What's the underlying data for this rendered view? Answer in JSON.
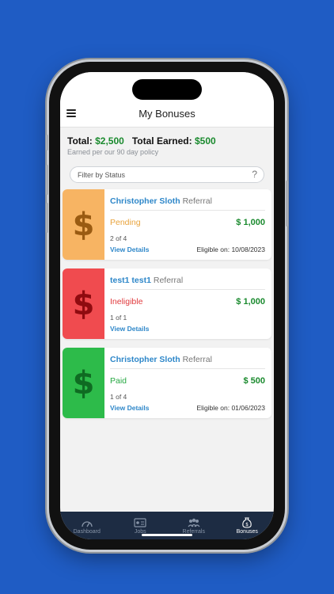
{
  "header": {
    "title": "My Bonuses",
    "menu_icon": "hamburger-icon"
  },
  "summary": {
    "total_label": "Total:",
    "total_value": "$2,500",
    "earned_label": "Total Earned:",
    "earned_value": "$500",
    "policy": "Earned per our 90 day policy"
  },
  "filter": {
    "placeholder": "Filter by Status",
    "help": "?"
  },
  "bonuses": [
    {
      "name": "Christopher Sloth",
      "type": "Referral",
      "status": "Pending",
      "amount": "$ 1,000",
      "count": "2 of 4",
      "view_label": "View Details",
      "eligible": "Eligible on: 10/08/2023",
      "side_color": "#f7b463",
      "icon_color": "#9a5b12",
      "status_color": "#e8a33c"
    },
    {
      "name": "test1 test1",
      "type": "Referral",
      "status": "Ineligible",
      "amount": "$ 1,000",
      "count": "1 of 1",
      "view_label": "View Details",
      "eligible": "",
      "side_color": "#f04b4f",
      "icon_color": "#8f0b10",
      "status_color": "#e0393c"
    },
    {
      "name": "Christopher Sloth",
      "type": "Referral",
      "status": "Paid",
      "amount": "$ 500",
      "count": "1 of 4",
      "view_label": "View Details",
      "eligible": "Eligible on: 01/06/2023",
      "side_color": "#2dbb4a",
      "icon_color": "#0f6b22",
      "status_color": "#27a843"
    }
  ],
  "tabs": [
    {
      "label": "Dashboard",
      "icon": "gauge-icon",
      "active": false
    },
    {
      "label": "Jobs",
      "icon": "id-card-icon",
      "active": false
    },
    {
      "label": "Referrals",
      "icon": "people-icon",
      "active": false
    },
    {
      "label": "Bonuses",
      "icon": "money-bag-icon",
      "active": true
    }
  ],
  "colors": {
    "background": "#1f5cc4",
    "accent": "#2e87c9",
    "money_green": "#1a8a2e",
    "tabbar": "#1d2c43"
  }
}
